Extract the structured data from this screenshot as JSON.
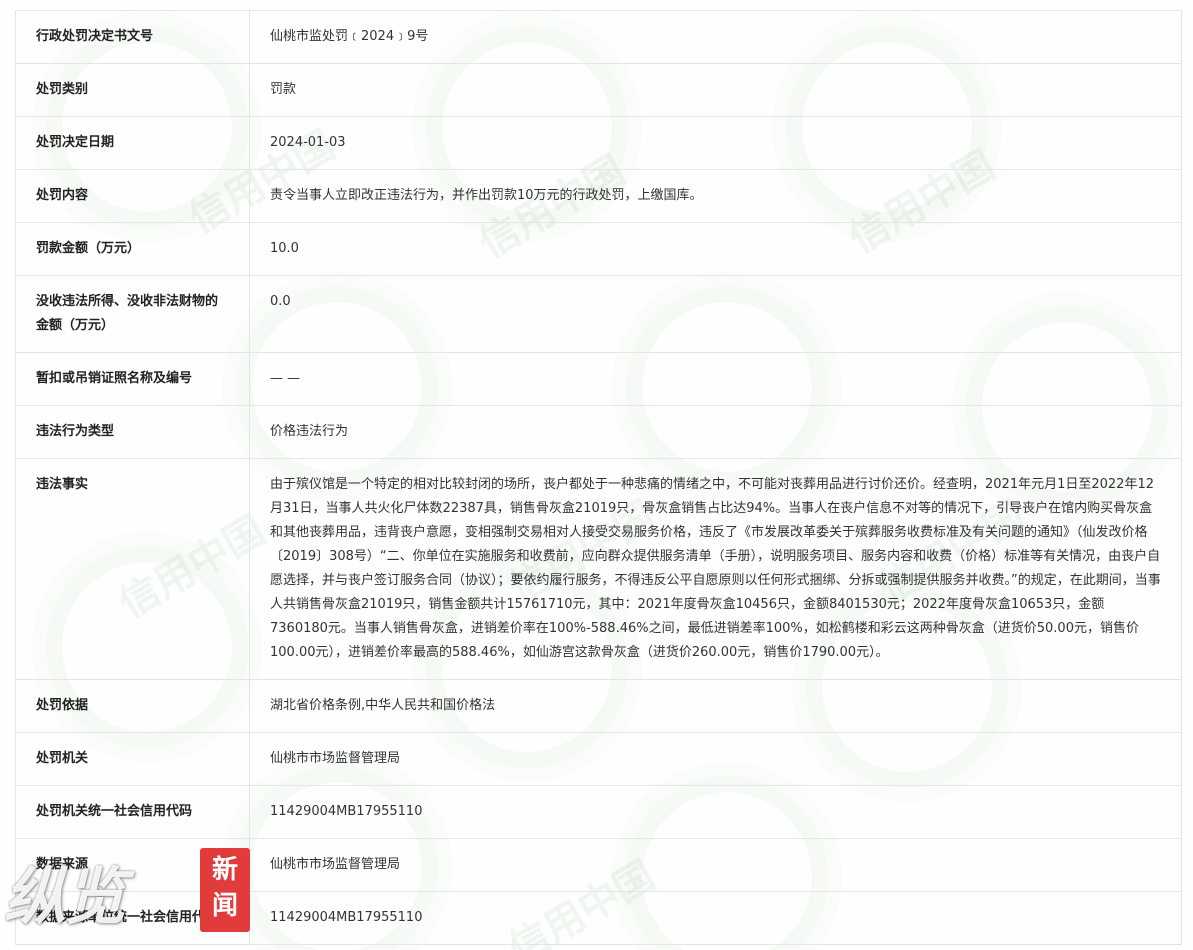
{
  "rows": [
    {
      "label": "行政处罚决定书文号",
      "value": "仙桃市监处罚﹝2024﹞9号"
    },
    {
      "label": "处罚类别",
      "value": "罚款"
    },
    {
      "label": "处罚决定日期",
      "value": "2024-01-03"
    },
    {
      "label": "处罚内容",
      "value": "责令当事人立即改正违法行为，并作出罚款10万元的行政处罚，上缴国库。"
    },
    {
      "label": "罚款金额（万元）",
      "value": "10.0"
    },
    {
      "label": "没收违法所得、没收非法财物的金额（万元）",
      "value": "0.0"
    },
    {
      "label": "暂扣或吊销证照名称及编号",
      "value": "— —"
    },
    {
      "label": "违法行为类型",
      "value": "价格违法行为"
    },
    {
      "label": "违法事实",
      "value": "由于殡仪馆是一个特定的相对比较封闭的场所，丧户都处于一种悲痛的情绪之中，不可能对丧葬用品进行讨价还价。经查明，2021年元月1日至2022年12月31日，当事人共火化尸体数22387具，销售骨灰盒21019只，骨灰盒销售占比达94%。当事人在丧户信息不对等的情况下，引导丧户在馆内购买骨灰盒和其他丧葬用品，违背丧户意愿，变相强制交易相对人接受交易服务价格，违反了《市发展改革委关于殡葬服务收费标准及有关问题的通知》（仙发改价格〔2019〕308号）“二、你单位在实施服务和收费前，应向群众提供服务清单（手册），说明服务项目、服务内容和收费（价格）标准等有关情况，由丧户自愿选择，并与丧户签订服务合同（协议）；要依约履行服务，不得违反公平自愿原则以任何形式捆绑、分拆或强制提供服务并收费。”的规定，在此期间，当事人共销售骨灰盒21019只，销售金额共计15761710元，其中：2021年度骨灰盒10456只，金额8401530元；2022年度骨灰盒10653只，金额7360180元。当事人销售骨灰盒，进销差价率在100%-588.46%之间，最低进销差率100%，如松鹤楼和彩云这两种骨灰盒（进货价50.00元，销售价100.00元），进销差价率最高的588.46%，如仙游宫这款骨灰盒（进货价260.00元，销售价1790.00元）。"
    },
    {
      "label": "处罚依据",
      "value": "湖北省价格条例,中华人民共和国价格法"
    },
    {
      "label": "处罚机关",
      "value": "仙桃市市场监督管理局"
    },
    {
      "label": "处罚机关统一社会信用代码",
      "value": "11429004MB17955110"
    },
    {
      "label": "数据来源",
      "value": "仙桃市市场监督管理局"
    },
    {
      "label": "数据来源单位统一社会信用代码",
      "value": "11429004MB17955110"
    }
  ],
  "watermark": {
    "text": "信用中国"
  },
  "logo": {
    "chars": "纵览",
    "badge_top": "新",
    "badge_bottom": "闻"
  }
}
